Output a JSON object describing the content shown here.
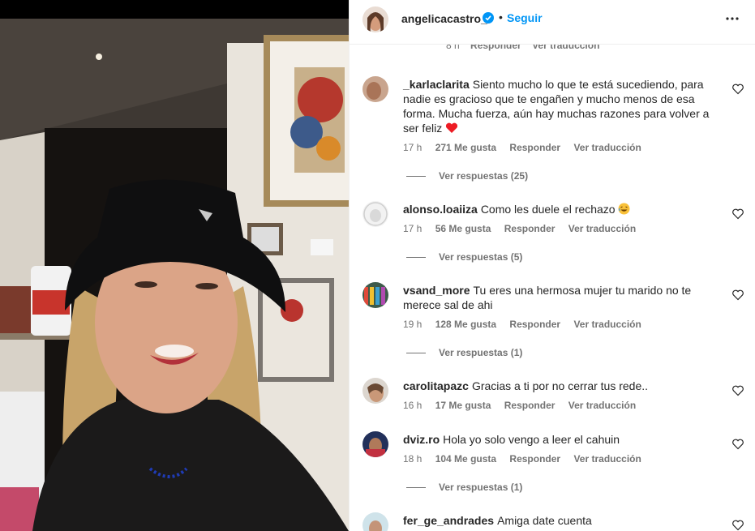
{
  "post": {
    "username": "angelicacastro_",
    "dot": "•",
    "follow_label": "Seguir",
    "colors": {
      "accent": "#0095f6",
      "verified": "#0095f6",
      "heart": "#ed4956"
    }
  },
  "previous_comment_meta": {
    "time": "8 h",
    "reply": "Responder",
    "translate": "Ver traducción"
  },
  "comments": [
    {
      "username": "_karlaclarita",
      "text": "Siento mucho lo que te está sucediendo, para nadie es gracioso que te engañen y mucho menos de esa forma. Mucha fuerza, aún hay muchas razones para volver a ser feliz",
      "time": "17 h",
      "likes": "271 Me gusta",
      "reply": "Responder",
      "translate": "Ver traducción",
      "replies": "Ver respuestas (25)",
      "emoji": "heart"
    },
    {
      "username": "alonso.loaiiza",
      "text": "Como les duele el rechazo",
      "time": "17 h",
      "likes": "56 Me gusta",
      "reply": "Responder",
      "translate": "Ver traducción",
      "replies": "Ver respuestas (5)",
      "emoji": "laughing-face"
    },
    {
      "username": "vsand_more",
      "text": "Tu eres una hermosa mujer tu marido no te merece sal de ahi",
      "time": "19 h",
      "likes": "128 Me gusta",
      "reply": "Responder",
      "translate": "Ver traducción",
      "replies": "Ver respuestas (1)"
    },
    {
      "username": "carolitapazc",
      "text": "Gracias a ti por no cerrar tus rede..",
      "time": "16 h",
      "likes": "17 Me gusta",
      "reply": "Responder",
      "translate": "Ver traducción"
    },
    {
      "username": "dviz.ro",
      "text": "Hola yo solo vengo a leer el cahuin",
      "time": "18 h",
      "likes": "104 Me gusta",
      "reply": "Responder",
      "translate": "Ver traducción",
      "replies": "Ver respuestas (1)"
    },
    {
      "username": "fer_ge_andrades",
      "text": "Amiga date cuenta"
    }
  ]
}
